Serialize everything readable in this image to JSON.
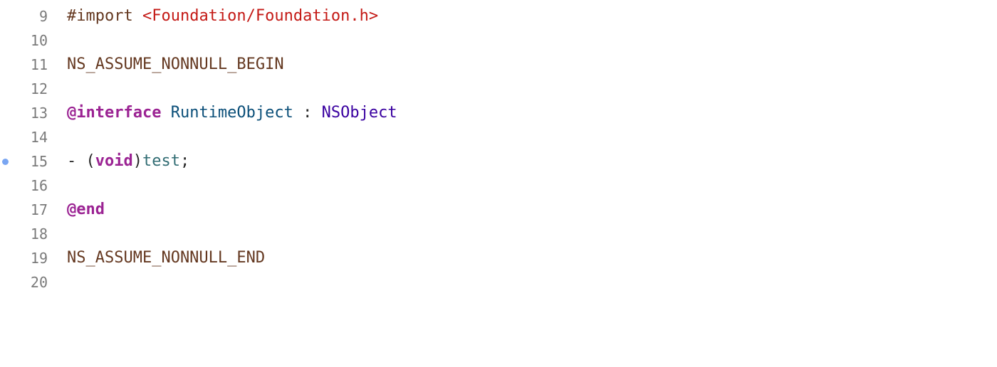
{
  "editor": {
    "language": "Objective-C",
    "change_marker_line": 15,
    "marker_color": "#7aa6f2",
    "colors": {
      "preprocessor": "#643820",
      "string": "#c41a16",
      "keyword": "#9b2393",
      "class_name": "#0b4f79",
      "system_type": "#3900a0",
      "method_name": "#326d74",
      "line_number": "#7a7a7a"
    },
    "lines": [
      {
        "number": "9",
        "tokens": [
          {
            "type": "preproc",
            "text": "#import "
          },
          {
            "type": "str",
            "text": "<Foundation/Foundation.h>"
          }
        ]
      },
      {
        "number": "10",
        "tokens": []
      },
      {
        "number": "11",
        "tokens": [
          {
            "type": "macro",
            "text": "NS_ASSUME_NONNULL_BEGIN"
          }
        ]
      },
      {
        "number": "12",
        "tokens": []
      },
      {
        "number": "13",
        "tokens": [
          {
            "type": "kw",
            "text": "@interface"
          },
          {
            "type": "plain",
            "text": " "
          },
          {
            "type": "cls",
            "text": "RuntimeObject"
          },
          {
            "type": "plain",
            "text": " : "
          },
          {
            "type": "sys",
            "text": "NSObject"
          }
        ]
      },
      {
        "number": "14",
        "tokens": []
      },
      {
        "number": "15",
        "tokens": [
          {
            "type": "plain",
            "text": "- ("
          },
          {
            "type": "kw",
            "text": "void"
          },
          {
            "type": "plain",
            "text": ")"
          },
          {
            "type": "fn",
            "text": "test"
          },
          {
            "type": "plain",
            "text": ";"
          }
        ]
      },
      {
        "number": "16",
        "tokens": []
      },
      {
        "number": "17",
        "tokens": [
          {
            "type": "kw",
            "text": "@end"
          }
        ]
      },
      {
        "number": "18",
        "tokens": []
      },
      {
        "number": "19",
        "tokens": [
          {
            "type": "macro",
            "text": "NS_ASSUME_NONNULL_END"
          }
        ]
      },
      {
        "number": "20",
        "tokens": []
      }
    ]
  }
}
